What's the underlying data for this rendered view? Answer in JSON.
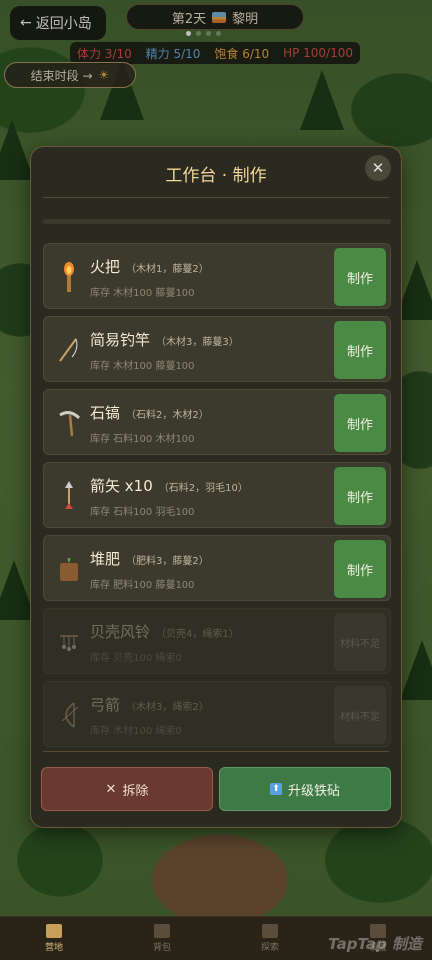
{
  "topbar": {
    "back_label": "返回小岛",
    "day_label": "第2天",
    "time_label": "黎明",
    "stats": [
      {
        "label": "体力 3/10",
        "color": "#e0504a"
      },
      {
        "label": "精力 5/10",
        "color": "#6ab0e8"
      },
      {
        "label": "饱食 6/10",
        "color": "#f0b04a"
      },
      {
        "label": "HP 100/100",
        "color": "#e0504a"
      }
    ],
    "end_phase_label": "结束时段 →",
    "end_phase_icon": "☀"
  },
  "modal": {
    "title": "工作台 · 制作",
    "close_icon": "✕",
    "items": [
      {
        "name": "火把",
        "recipe": "（木材1，藤蔓2）",
        "stock": "库存 木材100  藤蔓100",
        "button": "制作",
        "enabled": true,
        "icon": "torch-icon"
      },
      {
        "name": "简易钓竿",
        "recipe": "（木材3，藤蔓3）",
        "stock": "库存 木材100  藤蔓100",
        "button": "制作",
        "enabled": true,
        "icon": "fishing-rod-icon"
      },
      {
        "name": "石镐",
        "recipe": "（石料2，木材2）",
        "stock": "库存 石料100  木材100",
        "button": "制作",
        "enabled": true,
        "icon": "pickaxe-icon"
      },
      {
        "name": "箭矢 x10",
        "recipe": "（石料2，羽毛10）",
        "stock": "库存 石料100  羽毛100",
        "button": "制作",
        "enabled": true,
        "icon": "arrow-icon"
      },
      {
        "name": "堆肥",
        "recipe": "（肥料3，藤蔓2）",
        "stock": "库存 肥料100  藤蔓100",
        "button": "制作",
        "enabled": true,
        "icon": "compost-icon"
      },
      {
        "name": "贝壳风铃",
        "recipe": "（贝壳4，绳索1）",
        "stock": "库存 贝壳100  绳索0",
        "button": "材料不足",
        "enabled": false,
        "icon": "wind-chime-icon"
      },
      {
        "name": "弓箭",
        "recipe": "（木材3，绳索2）",
        "stock": "库存 木材100  绳索0",
        "button": "材料不足",
        "enabled": false,
        "icon": "bow-icon"
      }
    ],
    "dismantle_label": "拆除",
    "upgrade_label": "升级铁砧"
  },
  "nav": [
    {
      "label": "营地",
      "active": true
    },
    {
      "label": "背包",
      "active": false
    },
    {
      "label": "探索",
      "active": false
    },
    {
      "label": "设置",
      "active": false
    }
  ],
  "watermark": "TapTap 制造"
}
